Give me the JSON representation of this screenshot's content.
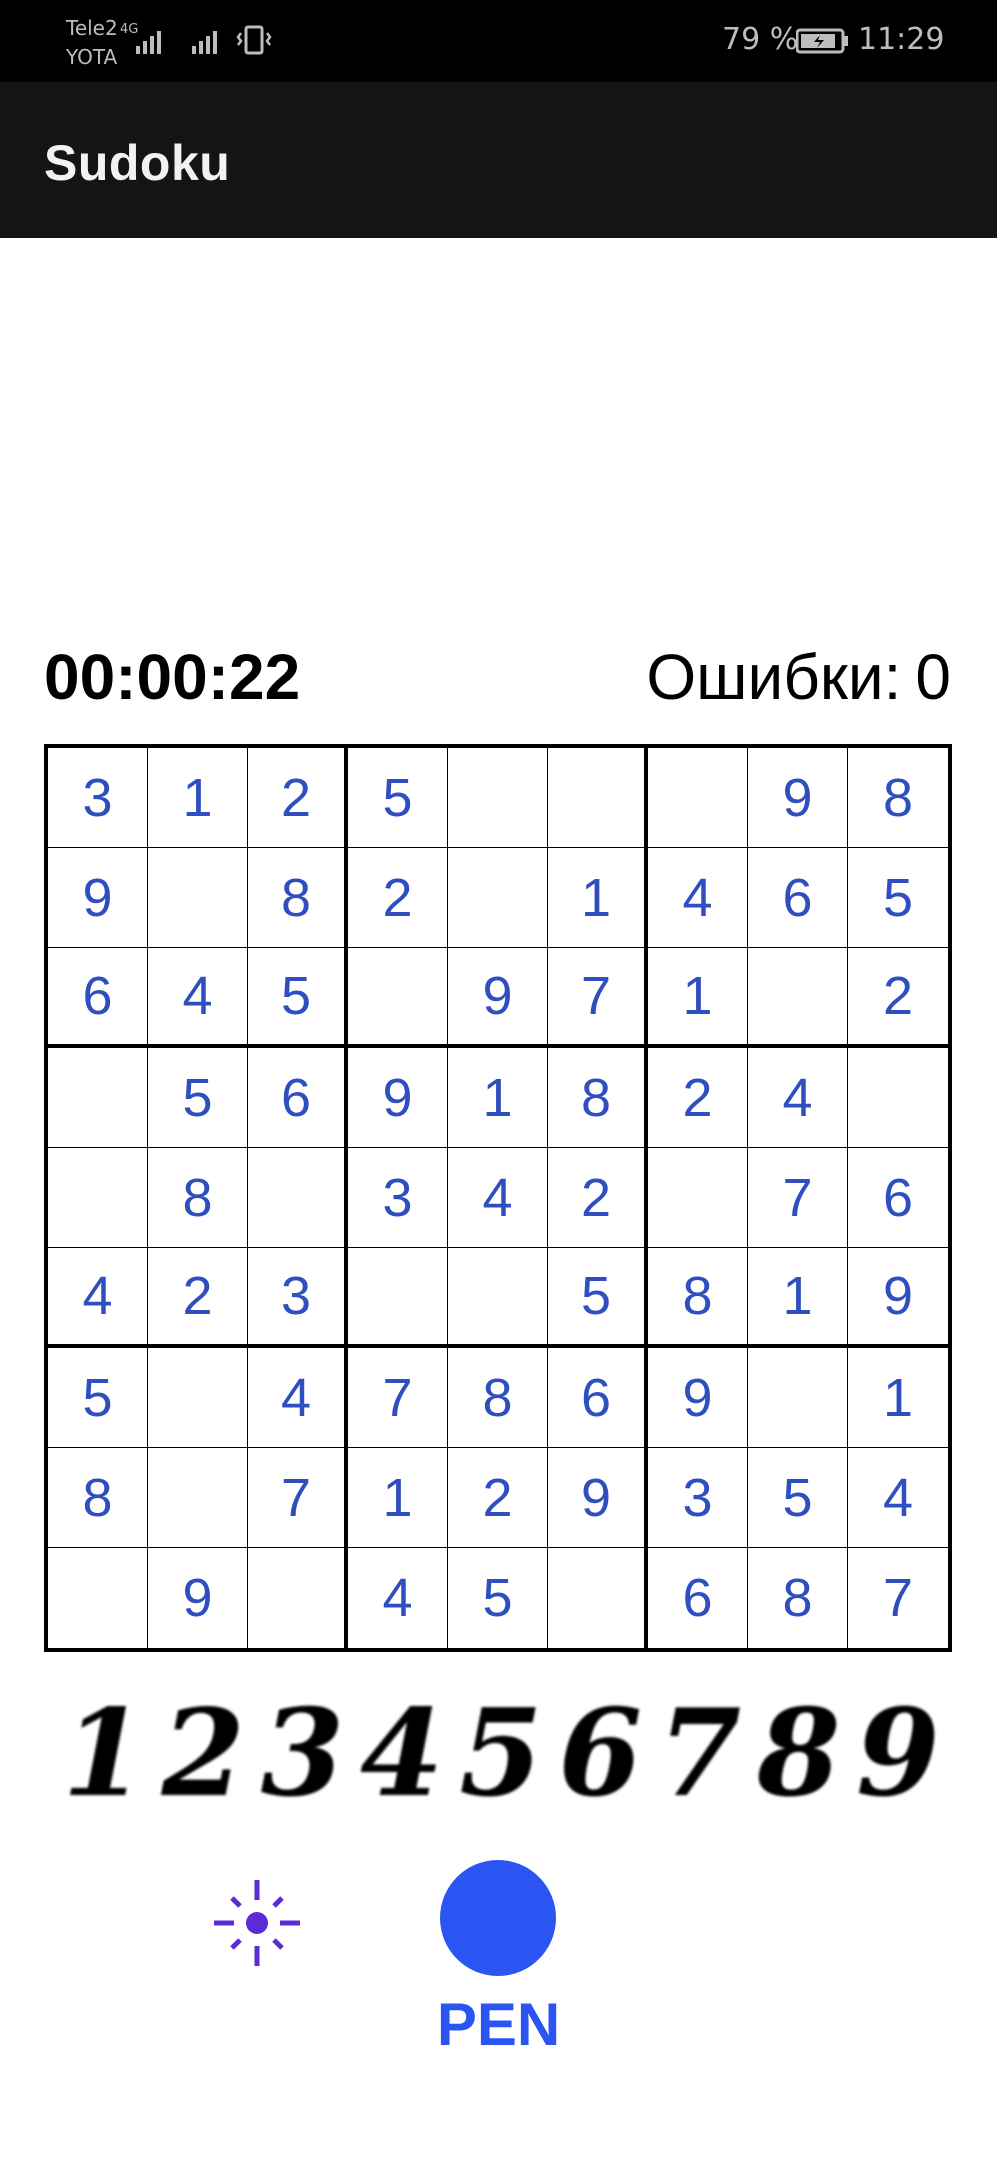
{
  "status_bar": {
    "carrier_1": "Tele2",
    "carrier_2": "YOTA",
    "network_tag": "4G",
    "battery_percent": "79 %",
    "time": "11:29"
  },
  "app_bar": {
    "title": "Sudoku"
  },
  "game": {
    "timer": "00:00:22",
    "errors_label": "Ошибки:",
    "errors_value": "0"
  },
  "board": [
    [
      "3",
      "1",
      "2",
      "5",
      "",
      "",
      "",
      "9",
      "8"
    ],
    [
      "9",
      "",
      "8",
      "2",
      "",
      "1",
      "4",
      "6",
      "5"
    ],
    [
      "6",
      "4",
      "5",
      "",
      "9",
      "7",
      "1",
      "",
      "2"
    ],
    [
      "",
      "5",
      "6",
      "9",
      "1",
      "8",
      "2",
      "4",
      ""
    ],
    [
      "",
      "8",
      "",
      "3",
      "4",
      "2",
      "",
      "7",
      "6"
    ],
    [
      "4",
      "2",
      "3",
      "",
      "",
      "5",
      "8",
      "1",
      "9"
    ],
    [
      "5",
      "",
      "4",
      "7",
      "8",
      "6",
      "9",
      "",
      "1"
    ],
    [
      "8",
      "",
      "7",
      "1",
      "2",
      "9",
      "3",
      "5",
      "4"
    ],
    [
      "",
      "9",
      "",
      "4",
      "5",
      "",
      "6",
      "8",
      "7"
    ]
  ],
  "numpad": [
    "1",
    "2",
    "3",
    "4",
    "5",
    "6",
    "7",
    "8",
    "9"
  ],
  "controls": {
    "hint_icon": "sparkle-icon",
    "pen_label": "PEN",
    "pen_color": "#2b55f2"
  }
}
